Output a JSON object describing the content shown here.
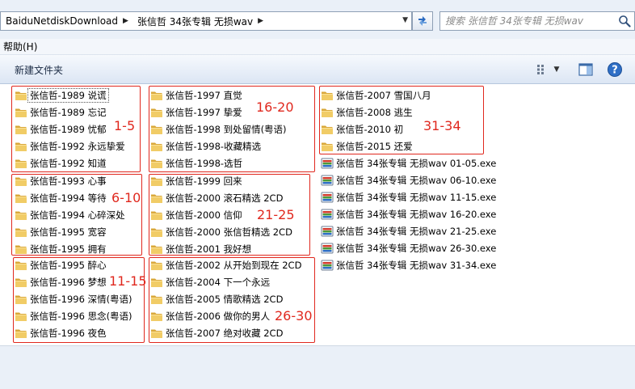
{
  "address_bar": {
    "crumbs": [
      "BaiduNetdiskDownload",
      "张信哲 34张专辑 无损wav"
    ]
  },
  "search": {
    "placeholder": "搜索 张信哲 34张专辑 无损wav"
  },
  "menu": {
    "help": "帮助(H)"
  },
  "toolbar": {
    "new_folder": "新建文件夹"
  },
  "files": {
    "col1": [
      "张信哲-1989 说谎",
      "张信哲-1989 忘记",
      "张信哲-1989 忧郁",
      "张信哲-1992 永远挚爱",
      "张信哲-1992 知道",
      "张信哲-1993 心事",
      "张信哲-1994 等待",
      "张信哲-1994 心碎深处",
      "张信哲-1995 宽容",
      "张信哲-1995 拥有",
      "张信哲-1995 醉心",
      "张信哲-1996 梦想",
      "张信哲-1996 深情(粤语)",
      "张信哲-1996 思念(粤语)",
      "张信哲-1996 夜色"
    ],
    "col2": [
      "张信哲-1997 直觉",
      "张信哲-1997 挚爱",
      "张信哲-1998 到处留情(粤语)",
      "张信哲-1998-收藏精选",
      "张信哲-1998-选哲",
      "张信哲-1999 回来",
      "张信哲-2000 滚石精选 2CD",
      "张信哲-2000 信仰",
      "张信哲-2000 张信哲精选 2CD",
      "张信哲-2001 我好想",
      "张信哲-2002 从开始到现在 2CD",
      "张信哲-2004 下一个永远",
      "张信哲-2005 情歌精选 2CD",
      "张信哲-2006 做你的男人",
      "张信哲-2007 绝对收藏 2CD"
    ],
    "col3_folders": [
      "张信哲-2007 雪国八月",
      "张信哲-2008 逃生",
      "张信哲-2010 初",
      "张信哲-2015 还爱"
    ],
    "col3_exes": [
      "张信哲 34张专辑 无损wav 01-05.exe",
      "张信哲 34张专辑 无损wav 06-10.exe",
      "张信哲 34张专辑 无损wav 11-15.exe",
      "张信哲 34张专辑 无损wav 16-20.exe",
      "张信哲 34张专辑 无损wav 21-25.exe",
      "张信哲 34张专辑 无损wav 26-30.exe",
      "张信哲 34张专辑 无损wav 31-34.exe"
    ]
  },
  "annotations": [
    "1-5",
    "6-10",
    "11-15",
    "16-20",
    "21-25",
    "26-30",
    "31-34"
  ],
  "colors": {
    "annotation": "#e0281e",
    "folder": "#e9c25a"
  }
}
